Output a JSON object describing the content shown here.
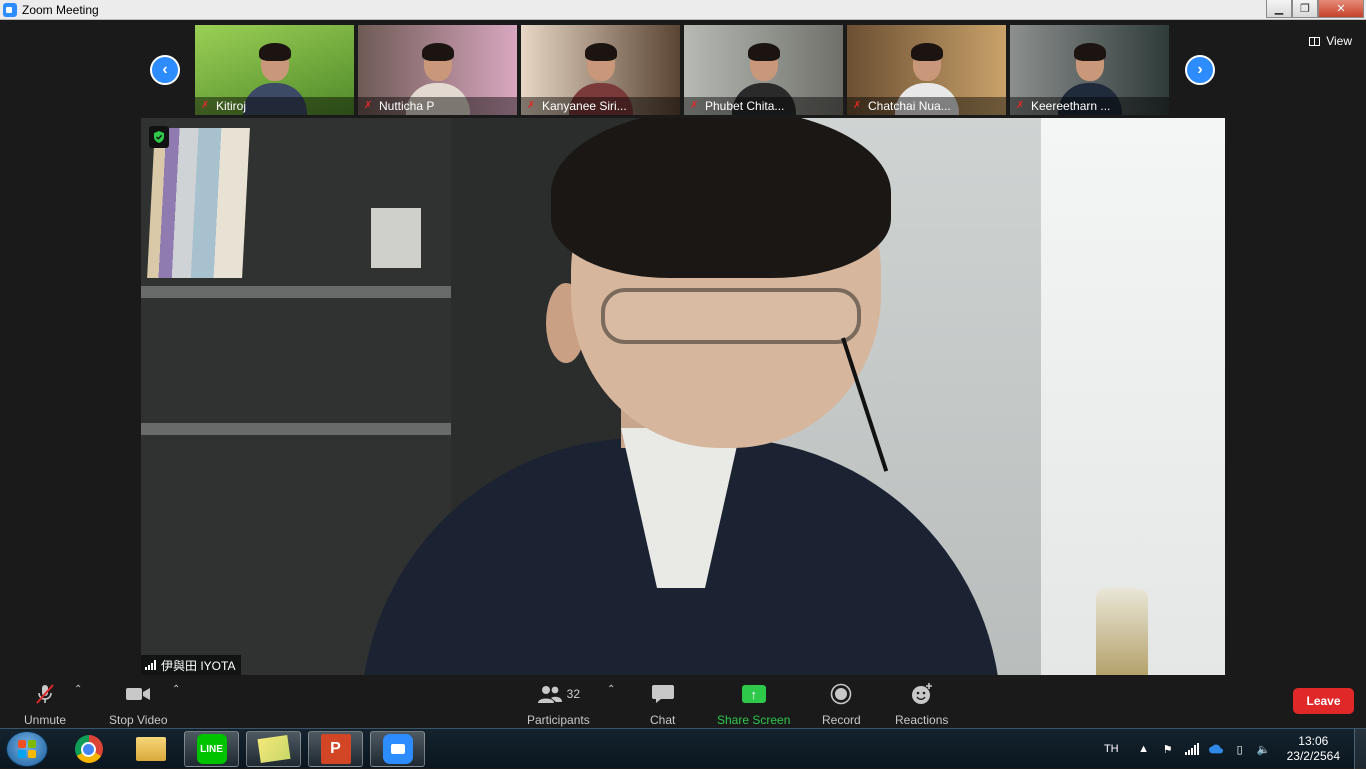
{
  "window": {
    "title": "Zoom Meeting"
  },
  "gallery": {
    "view_label": "View",
    "participants": [
      {
        "name": "Kitiroj",
        "bg": "#6fa33a"
      },
      {
        "name": "Nutticha P",
        "bg": "#b98aa0"
      },
      {
        "name": "Kanyanee Siri...",
        "bg": "#8a6a55"
      },
      {
        "name": "Phubet Chita...",
        "bg": "#9a9e96"
      },
      {
        "name": "Chatchai Nua...",
        "bg": "#8d7652"
      },
      {
        "name": "Keereetharn ...",
        "bg": "#5a6470"
      }
    ]
  },
  "active_speaker": {
    "name": "伊與田 IYOTA"
  },
  "toolbar": {
    "unmute": "Unmute",
    "stop_video": "Stop Video",
    "participants": "Participants",
    "participant_count": "32",
    "chat": "Chat",
    "share_screen": "Share Screen",
    "record": "Record",
    "reactions": "Reactions",
    "leave": "Leave"
  },
  "taskbar": {
    "language": "TH",
    "time": "13:06",
    "date": "23/2/2564",
    "ppt_letter": "P",
    "line_label": "LINE"
  },
  "colors": {
    "accent": "#2d8cff",
    "share_green": "#2ec84a",
    "leave_red": "#e02828",
    "muted_red": "#e02828"
  }
}
